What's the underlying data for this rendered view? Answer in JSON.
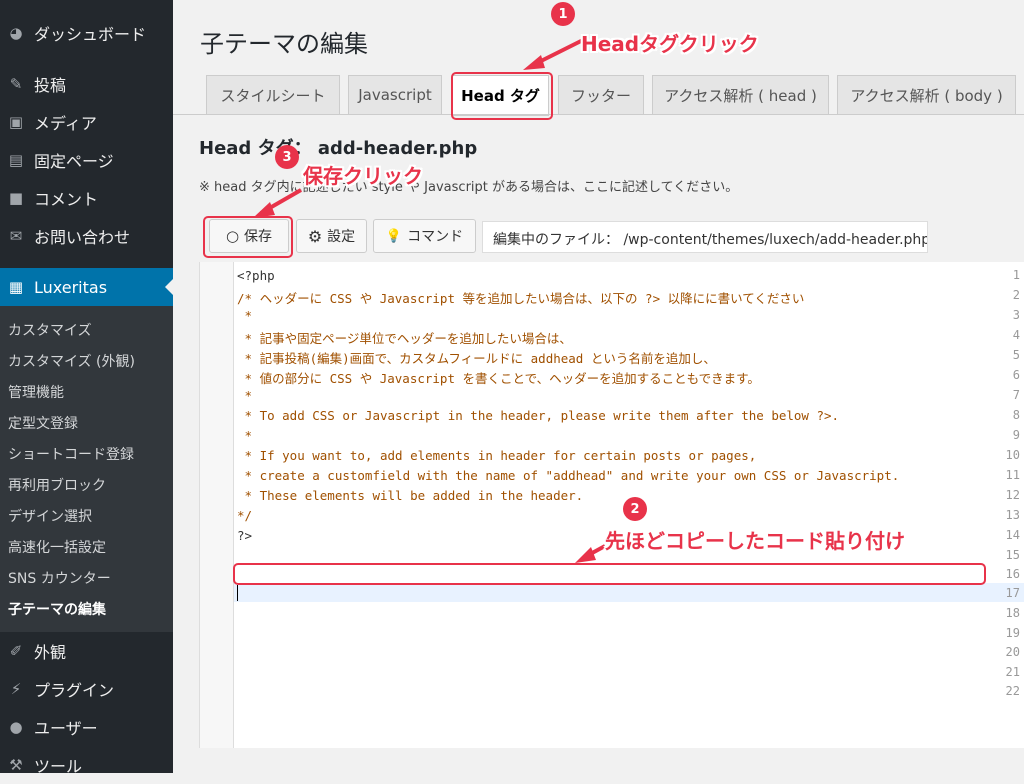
{
  "sidebar": {
    "top_items": [
      {
        "label": "ダッシュボード",
        "icon": "dashboard-icon"
      },
      {
        "label": "投稿",
        "icon": "pin-icon"
      },
      {
        "label": "メディア",
        "icon": "media-icon"
      },
      {
        "label": "固定ページ",
        "icon": "page-icon"
      },
      {
        "label": "コメント",
        "icon": "comment-icon"
      },
      {
        "label": "お問い合わせ",
        "icon": "mail-icon"
      }
    ],
    "active_item": {
      "label": "Luxeritas",
      "icon": "grid-icon"
    },
    "submenu": [
      "カスタマイズ",
      "カスタマイズ (外観)",
      "管理機能",
      "定型文登録",
      "ショートコード登録",
      "再利用ブロック",
      "デザイン選択",
      "高速化一括設定",
      "SNS カウンター",
      "子テーマの編集"
    ],
    "current_submenu": "子テーマの編集",
    "bottom_items": [
      {
        "label": "外観",
        "icon": "brush-icon"
      },
      {
        "label": "プラグイン",
        "icon": "plugin-icon"
      },
      {
        "label": "ユーザー",
        "icon": "user-icon"
      },
      {
        "label": "ツール",
        "icon": "wrench-icon"
      }
    ]
  },
  "page": {
    "title": "子テーマの編集",
    "tabs": [
      "スタイルシート",
      "Javascript",
      "Head タグ",
      "フッター",
      "アクセス解析 ( head )",
      "アクセス解析 ( body )"
    ],
    "selected_tab": "Head タグ",
    "file_heading": "Head タグ： add-header.php",
    "notice": "※ head タグ内に記述したい style や Javascript がある場合は、ここに記述してください。",
    "buttons": {
      "save": "保存",
      "settings": "設定",
      "command": "コマンド"
    },
    "file_path": "編集中のファイル： /wp-content/themes/luxech/add-header.php"
  },
  "editor": {
    "line_numbers": [
      "1",
      "2",
      "3",
      "4",
      "5",
      "6",
      "7",
      "8",
      "9",
      "10",
      "11",
      "12",
      "13",
      "14",
      "15",
      "16",
      "17",
      "18",
      "19",
      "20",
      "21",
      "22"
    ],
    "lines": [
      "<?php",
      "/* ヘッダーに CSS や Javascript 等を追加したい場合は、以下の ?> 以降にに書いてください",
      " *",
      " * 記事や固定ページ単位でヘッダーを追加したい場合は、",
      " * 記事投稿(編集)画面で、カスタムフィールドに addhead という名前を追加し、",
      " * 値の部分に CSS や Javascript を書くことで、ヘッダーを追加することもできます。",
      " *",
      " * To add CSS or Javascript in the header, please write them after the below ?>.",
      " *",
      " * If you want to, add elements in header for certain posts or pages,",
      " * create a customfield with the name of \"addhead\" and write your own CSS or Javascript.",
      " * These elements will be added in the header.",
      "*/",
      "?>",
      "",
      "",
      "",
      "",
      "",
      "",
      "",
      ""
    ]
  },
  "annotations": [
    {
      "number": "1",
      "text": "Headタグクリック"
    },
    {
      "number": "2",
      "text": "先ほどコピーしたコード貼り付け"
    },
    {
      "number": "3",
      "text": "保存クリック"
    }
  ],
  "colors": {
    "sidebar_bg": "#23282d",
    "active_blue": "#0073aa",
    "annotation_red": "#e8334a"
  }
}
